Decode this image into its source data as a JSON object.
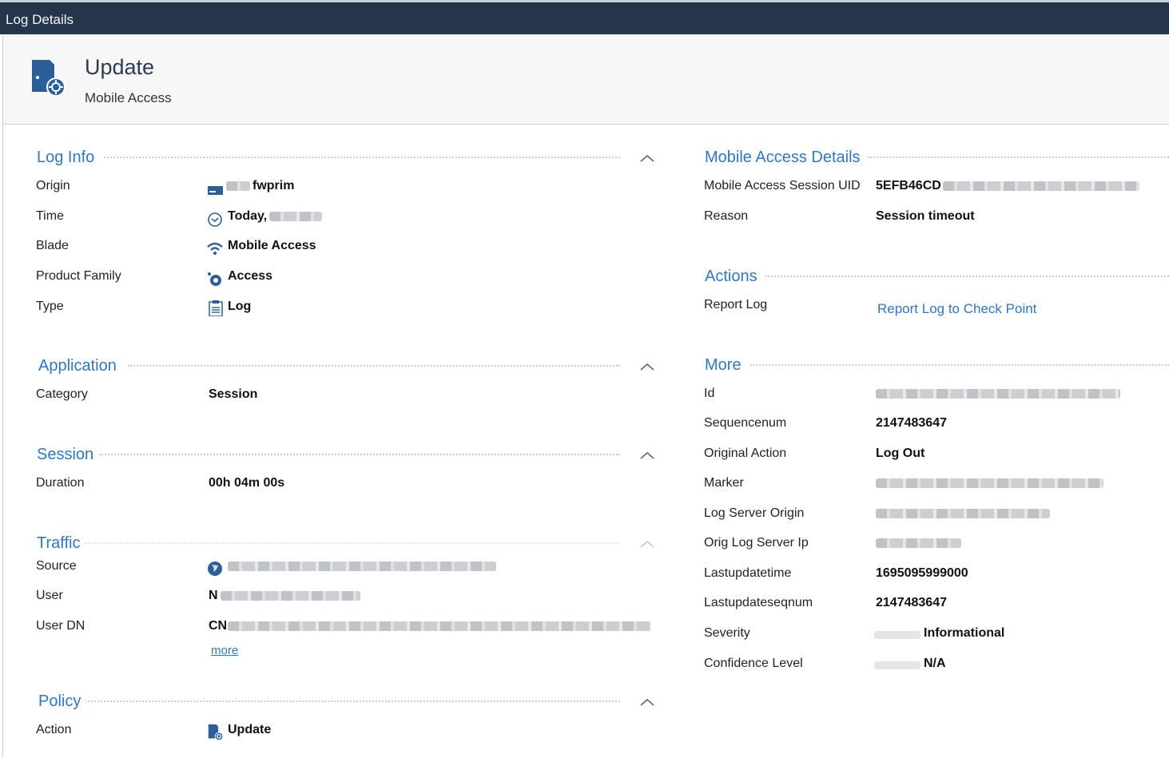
{
  "window": {
    "title": "Log Details"
  },
  "header": {
    "title": "Update",
    "subtitle": "Mobile Access"
  },
  "log_info": {
    "title": "Log Info",
    "rows": [
      {
        "label": "Origin",
        "value": "fwprim"
      },
      {
        "label": "Time",
        "value": "Today,"
      },
      {
        "label": "Blade",
        "value": "Mobile Access"
      },
      {
        "label": "Product Family",
        "value": "Access"
      },
      {
        "label": "Type",
        "value": "Log"
      }
    ]
  },
  "application": {
    "title": "Application",
    "rows": [
      {
        "label": "Category",
        "value": "Session"
      }
    ]
  },
  "session": {
    "title": "Session",
    "rows": [
      {
        "label": "Duration",
        "value": "00h 04m 00s"
      }
    ]
  },
  "traffic": {
    "title": "Traffic",
    "rows": [
      {
        "label": "Source",
        "value": ""
      },
      {
        "label": "User",
        "value": "N"
      },
      {
        "label": "User DN",
        "value": "CN"
      }
    ],
    "more_label": "more"
  },
  "policy": {
    "title": "Policy",
    "rows": [
      {
        "label": "Action",
        "value": "Update"
      }
    ]
  },
  "mobile_access_details": {
    "title": "Mobile Access Details",
    "rows": [
      {
        "label": "Mobile Access Session UID",
        "value": "5EFB46CD"
      },
      {
        "label": "Reason",
        "value": "Session timeout"
      }
    ]
  },
  "actions": {
    "title": "Actions",
    "rows": [
      {
        "label": "Report Log",
        "value": "Report Log to Check Point"
      }
    ]
  },
  "more": {
    "title": "More",
    "rows": [
      {
        "label": "Id",
        "value": ""
      },
      {
        "label": "Sequencenum",
        "value": "2147483647"
      },
      {
        "label": "Original Action",
        "value": "Log Out"
      },
      {
        "label": "Marker",
        "value": ""
      },
      {
        "label": "Log Server Origin",
        "value": ""
      },
      {
        "label": "Orig Log Server Ip",
        "value": ""
      },
      {
        "label": "Lastupdatetime",
        "value": "1695095999000"
      },
      {
        "label": "Lastupdateseqnum",
        "value": "2147483647"
      },
      {
        "label": "Severity",
        "value": "Informational"
      },
      {
        "label": "Confidence Level",
        "value": "N/A"
      }
    ]
  },
  "colors": {
    "titlebar": "#25364c",
    "accent": "#2f78c3",
    "header_bg": "#f7f7f7"
  },
  "icons": [
    "update-blade-icon",
    "gateway-icon",
    "clock-icon",
    "wifi-icon",
    "access-icon",
    "log-document-icon",
    "globe-icon",
    "chevron-up-icon"
  ]
}
